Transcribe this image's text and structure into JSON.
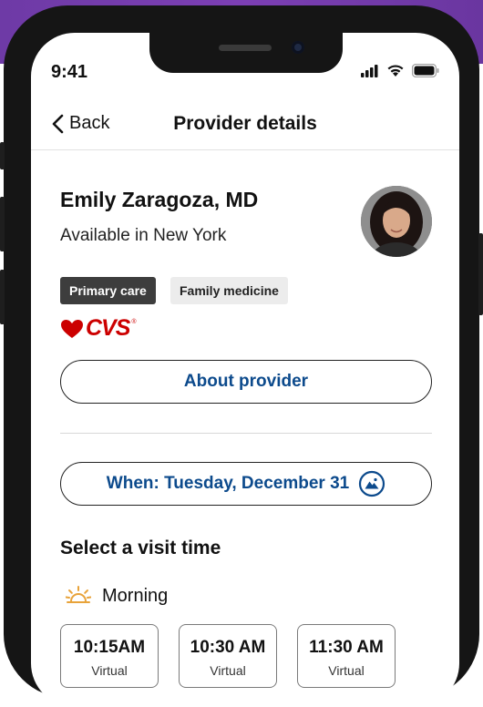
{
  "status_bar": {
    "time": "9:41"
  },
  "header": {
    "back_label": "Back",
    "title": "Provider details"
  },
  "provider": {
    "name": "Emily Zaragoza, MD",
    "location": "Available in New York",
    "tags": [
      "Primary care",
      "Family medicine"
    ],
    "brand_logo_text": "CVS",
    "brand_color": "#cc0000"
  },
  "about_button_label": "About provider",
  "date_button_label": "When: Tuesday, December 31",
  "visit_section": {
    "title": "Select a visit time",
    "period_label": "Morning",
    "slots": [
      {
        "time": "10:15AM",
        "type": "Virtual"
      },
      {
        "time": "10:30 AM",
        "type": "Virtual"
      },
      {
        "time": "11:30 AM",
        "type": "Virtual"
      }
    ]
  },
  "colors": {
    "accent": "#0c4a8c",
    "frame": "#151515",
    "backdrop": "#7c3fb4",
    "sun": "#e8a33a"
  }
}
